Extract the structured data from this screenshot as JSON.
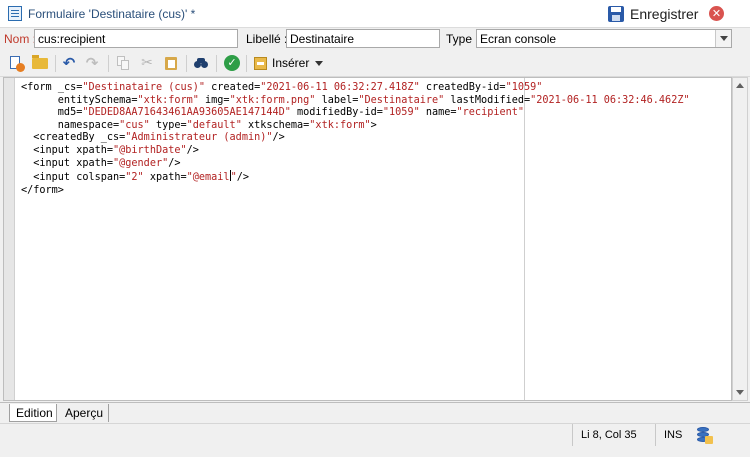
{
  "window": {
    "title": "Formulaire 'Destinataire (cus)' *",
    "save_label": "Enregistrer",
    "close_symbol": "✕"
  },
  "fields": {
    "nom_label": "Nom :",
    "nom_value": "cus:recipient",
    "libelle_label": "Libellé :",
    "libelle_value": "Destinataire",
    "type_label": "Type :",
    "type_value": "Ecran console"
  },
  "toolbar": {
    "undo_symbol": "↶",
    "redo_symbol": "↷",
    "cut_symbol": "✂",
    "check_symbol": "✓",
    "insert_label": "Insérer",
    "icons": [
      "new-icon",
      "open-folder-icon",
      "undo-icon",
      "redo-icon",
      "copy-icon",
      "cut-icon",
      "paste-icon",
      "find-icon",
      "validate-icon",
      "insert-icon"
    ]
  },
  "editor": {
    "lines": [
      [
        [
          "p",
          "<form "
        ],
        [
          "a",
          "_cs="
        ],
        [
          "v",
          "\"Destinataire (cus)\""
        ],
        [
          "a",
          " created="
        ],
        [
          "v",
          "\"2021-06-11 06:32:27.418Z\""
        ],
        [
          "a",
          " createdBy-id="
        ],
        [
          "v",
          "\"1059\""
        ]
      ],
      [
        [
          "a",
          "      entitySchema="
        ],
        [
          "v",
          "\"xtk:form\""
        ],
        [
          "a",
          " img="
        ],
        [
          "v",
          "\"xtk:form.png\""
        ],
        [
          "a",
          " label="
        ],
        [
          "v",
          "\"Destinataire\""
        ],
        [
          "a",
          " lastModified="
        ],
        [
          "v",
          "\"2021-06-11 06:32:46.462Z\""
        ]
      ],
      [
        [
          "a",
          "      md5="
        ],
        [
          "v",
          "\"DEDED8AA71643461AA93605AE147144D\""
        ],
        [
          "a",
          " modifiedBy-id="
        ],
        [
          "v",
          "\"1059\""
        ],
        [
          "a",
          " name="
        ],
        [
          "v",
          "\"recipient\""
        ]
      ],
      [
        [
          "a",
          "      namespace="
        ],
        [
          "v",
          "\"cus\""
        ],
        [
          "a",
          " type="
        ],
        [
          "v",
          "\"default\""
        ],
        [
          "a",
          " xtkschema="
        ],
        [
          "v",
          "\"xtk:form\""
        ],
        [
          "p",
          ">"
        ]
      ],
      [
        [
          "p",
          "  <createdBy "
        ],
        [
          "a",
          "_cs="
        ],
        [
          "v",
          "\"Administrateur (admin)\""
        ],
        [
          "p",
          "/>"
        ]
      ],
      [
        [
          "p",
          "  <input "
        ],
        [
          "a",
          "xpath="
        ],
        [
          "v",
          "\"@birthDate\""
        ],
        [
          "p",
          "/>"
        ]
      ],
      [
        [
          "p",
          "  <input "
        ],
        [
          "a",
          "xpath="
        ],
        [
          "v",
          "\"@gender\""
        ],
        [
          "p",
          "/>"
        ]
      ],
      [
        [
          "p",
          "  <input "
        ],
        [
          "a",
          "colspan="
        ],
        [
          "v",
          "\"2\""
        ],
        [
          "a",
          " xpath="
        ],
        [
          "v",
          "\"@email"
        ],
        [
          "c",
          ""
        ],
        [
          "v",
          "\""
        ],
        [
          "p",
          "/>"
        ]
      ],
      [
        [
          "p",
          "</form>"
        ]
      ]
    ]
  },
  "tabs": {
    "edition": "Edition",
    "apercu": "Aperçu"
  },
  "status": {
    "position": "Li 8, Col 35",
    "mode": "INS"
  }
}
